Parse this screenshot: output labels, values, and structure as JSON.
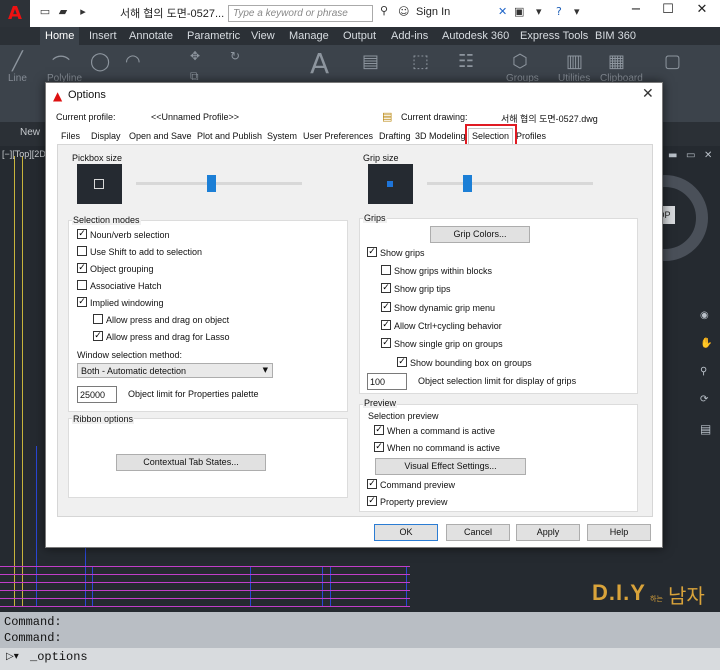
{
  "app": {
    "document_title": "서해 협의 도면-0527...",
    "search_placeholder": "Type a keyword or phrase",
    "signin_label": "Sign In",
    "ribbon_tabs": [
      "Home",
      "Insert",
      "Annotate",
      "Parametric",
      "View",
      "Manage",
      "Output",
      "Add-ins",
      "Autodesk 360",
      "Express Tools",
      "BIM 360"
    ],
    "ribbon_labels": {
      "line": "Line",
      "polyline": "Polyline",
      "groups": "Groups",
      "utilities": "Utilities",
      "clipboard": "Clipboard"
    },
    "file_tab_label": "New",
    "viewport_label": "[−][Top][2D",
    "compass_label": "OP",
    "command_lines": [
      "Command:",
      "Command:"
    ],
    "command_input": "_options",
    "watermark": {
      "brand": "D.I.Y",
      "small": "하는",
      "suffix": "남자"
    }
  },
  "dialog": {
    "title": "Options",
    "current_profile_label": "Current profile:",
    "current_profile_value": "<<Unnamed Profile>>",
    "current_drawing_label": "Current drawing:",
    "current_drawing_value": "서해 협의 도면-0527.dwg",
    "tabs": [
      "Files",
      "Display",
      "Open and Save",
      "Plot and Publish",
      "System",
      "User Preferences",
      "Drafting",
      "3D Modeling",
      "Selection",
      "Profiles"
    ],
    "active_tab": "Selection",
    "pickbox_title": "Pickbox size",
    "grip_size_title": "Grip size",
    "selection_modes": {
      "title": "Selection modes",
      "items": [
        {
          "label": "Noun/verb selection",
          "checked": true
        },
        {
          "label": "Use Shift to add to selection",
          "checked": false
        },
        {
          "label": "Object grouping",
          "checked": true
        },
        {
          "label": "Associative Hatch",
          "checked": false
        },
        {
          "label": "Implied windowing",
          "checked": true
        },
        {
          "label": "Allow press and drag on object",
          "checked": false
        },
        {
          "label": "Allow press and drag for Lasso",
          "checked": true
        }
      ],
      "window_method_label": "Window selection method:",
      "window_method_value": "Both - Automatic detection",
      "object_limit_value": "25000",
      "object_limit_label": "Object limit for Properties palette"
    },
    "ribbon_options": {
      "title": "Ribbon options",
      "button": "Contextual Tab States..."
    },
    "grips": {
      "title": "Grips",
      "colors_button": "Grip Colors...",
      "items": [
        {
          "label": "Show grips",
          "checked": true
        },
        {
          "label": "Show grips within blocks",
          "checked": false
        },
        {
          "label": "Show grip tips",
          "checked": true
        },
        {
          "label": "Show dynamic grip menu",
          "checked": true
        },
        {
          "label": "Allow Ctrl+cycling behavior",
          "checked": true
        },
        {
          "label": "Show single grip on groups",
          "checked": true
        },
        {
          "label": "Show bounding box on groups",
          "checked": true
        }
      ],
      "limit_value": "100",
      "limit_label": "Object selection limit for display of grips"
    },
    "preview": {
      "title": "Preview",
      "selection_preview_label": "Selection preview",
      "items": [
        {
          "label": "When a command is active",
          "checked": true
        },
        {
          "label": "When no command is active",
          "checked": true
        }
      ],
      "visual_button": "Visual Effect Settings...",
      "command_preview": {
        "label": "Command preview",
        "checked": true
      },
      "property_preview": {
        "label": "Property preview",
        "checked": true
      }
    },
    "buttons": {
      "ok": "OK",
      "cancel": "Cancel",
      "apply": "Apply",
      "help": "Help"
    },
    "pickbox_slider_level": 0.45,
    "grip_slider_level": 0.23
  }
}
